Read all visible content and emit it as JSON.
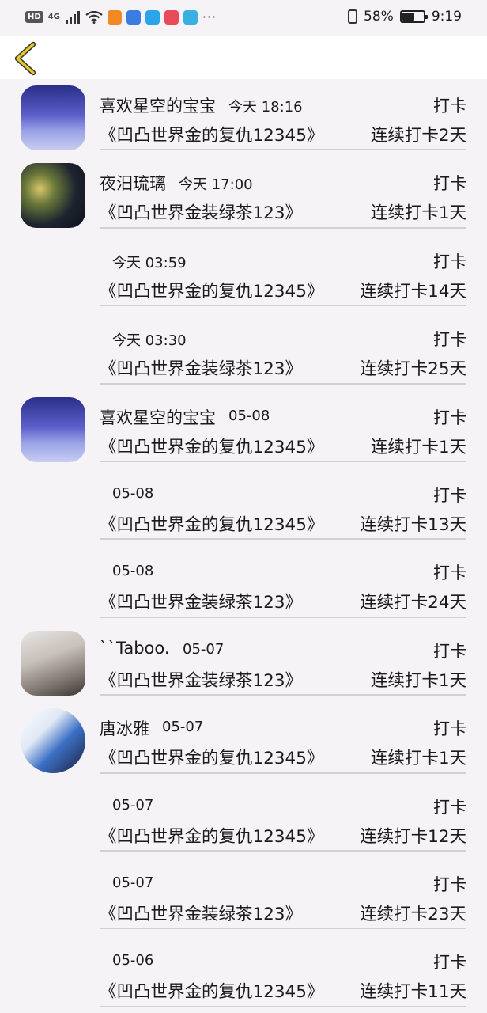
{
  "status_bar": {
    "hd": "HD",
    "network": "4G",
    "battery_percent": "58%",
    "battery_level": 0.58,
    "time": "9:19",
    "more": "···",
    "app_icon_colors": [
      "#f08a24",
      "#3a7de0",
      "#2aa6e8",
      "#e84a5a",
      "#3ab0e0"
    ]
  },
  "nav": {
    "back_icon": "chevron-left-icon",
    "accent": "#e3c832"
  },
  "checkins": [
    {
      "avatar": "sky",
      "name": "喜欢星空的宝宝",
      "time": "今天 18:16",
      "action": "打卡",
      "book": "《凹凸世界金的复仇12345》",
      "streak": "连续打卡2天"
    },
    {
      "avatar": "girl",
      "name": "夜汨琉璃",
      "time": "今天 17:00",
      "action": "打卡",
      "book": "《凹凸世界金装绿茶123》",
      "streak": "连续打卡1天"
    },
    {
      "avatar": "",
      "name": "",
      "time": "今天 03:59",
      "action": "打卡",
      "book": "《凹凸世界金的复仇12345》",
      "streak": "连续打卡14天"
    },
    {
      "avatar": "",
      "name": "",
      "time": "今天 03:30",
      "action": "打卡",
      "book": "《凹凸世界金装绿茶123》",
      "streak": "连续打卡25天"
    },
    {
      "avatar": "sky",
      "name": "喜欢星空的宝宝",
      "time": "05-08",
      "action": "打卡",
      "book": "《凹凸世界金的复仇12345》",
      "streak": "连续打卡1天"
    },
    {
      "avatar": "",
      "name": "",
      "time": "05-08",
      "action": "打卡",
      "book": "《凹凸世界金的复仇12345》",
      "streak": "连续打卡13天"
    },
    {
      "avatar": "",
      "name": "",
      "time": "05-08",
      "action": "打卡",
      "book": "《凹凸世界金装绿茶123》",
      "streak": "连续打卡24天"
    },
    {
      "avatar": "taboo",
      "name": "``Taboo.",
      "time": "05-07",
      "action": "打卡",
      "book": "《凹凸世界金装绿茶123》",
      "streak": "连续打卡1天"
    },
    {
      "avatar": "duo",
      "name": "唐冰雅",
      "time": "05-07",
      "action": "打卡",
      "book": "《凹凸世界金的复仇12345》",
      "streak": "连续打卡1天"
    },
    {
      "avatar": "",
      "name": "",
      "time": "05-07",
      "action": "打卡",
      "book": "《凹凸世界金的复仇12345》",
      "streak": "连续打卡12天"
    },
    {
      "avatar": "",
      "name": "",
      "time": "05-07",
      "action": "打卡",
      "book": "《凹凸世界金装绿茶123》",
      "streak": "连续打卡23天"
    },
    {
      "avatar": "",
      "name": "",
      "time": "05-06",
      "action": "打卡",
      "book": "《凹凸世界金的复仇12345》",
      "streak": "连续打卡11天"
    }
  ]
}
